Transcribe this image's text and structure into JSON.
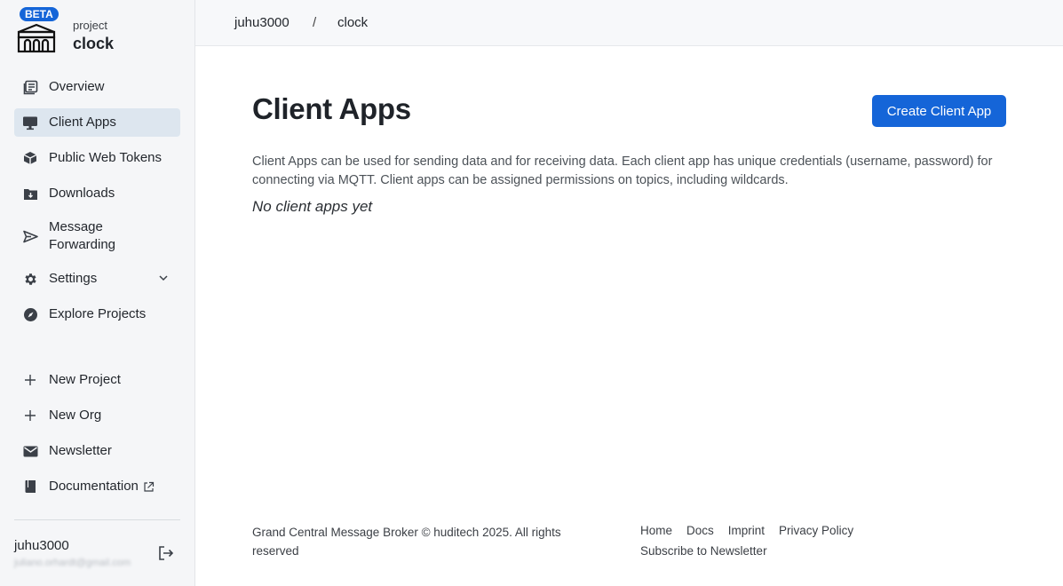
{
  "sidebar": {
    "beta_badge": "BETA",
    "project_label": "project",
    "project_name": "clock",
    "nav": [
      {
        "label": "Overview",
        "icon": "overview-icon"
      },
      {
        "label": "Client Apps",
        "icon": "monitor-icon",
        "active": true
      },
      {
        "label": "Public Web Tokens",
        "icon": "cube-icon"
      },
      {
        "label": "Downloads",
        "icon": "download-folder-icon"
      },
      {
        "label": "Message\nForwarding",
        "line1": "Message",
        "line2": "Forwarding",
        "icon": "send-icon"
      },
      {
        "label": "Settings",
        "icon": "gear-icon"
      },
      {
        "label": "Explore Projects",
        "icon": "compass-icon"
      }
    ],
    "nav2": [
      {
        "label": "New Project",
        "icon": "plus-icon"
      },
      {
        "label": "New Org",
        "icon": "plus-icon"
      },
      {
        "label": "Newsletter",
        "icon": "mail-icon"
      },
      {
        "label": "Documentation",
        "icon": "book-icon"
      }
    ],
    "user": {
      "name": "juhu3000",
      "email": "juliano.orhardt@gmail.com"
    }
  },
  "topbar": {
    "org": "juhu3000",
    "separator": "/",
    "project": "clock"
  },
  "main": {
    "title": "Client Apps",
    "create_button": "Create Client App",
    "description": "Client Apps can be used for sending data and for receiving data. Each client app has unique credentials (username, password) for connecting via MQTT. Client apps can be assigned permissions on topics, including wildcards.",
    "empty_state": "No client apps yet"
  },
  "footer": {
    "copyright": "Grand Central Message Broker © huditech 2025. All rights reserved",
    "links": [
      "Home",
      "Docs",
      "Imprint",
      "Privacy Policy"
    ],
    "subscribe": "Subscribe to Newsletter"
  },
  "colors": {
    "accent": "#1565d8",
    "sidebar_bg": "#f5f6f8",
    "active_item": "#dde6ef"
  }
}
